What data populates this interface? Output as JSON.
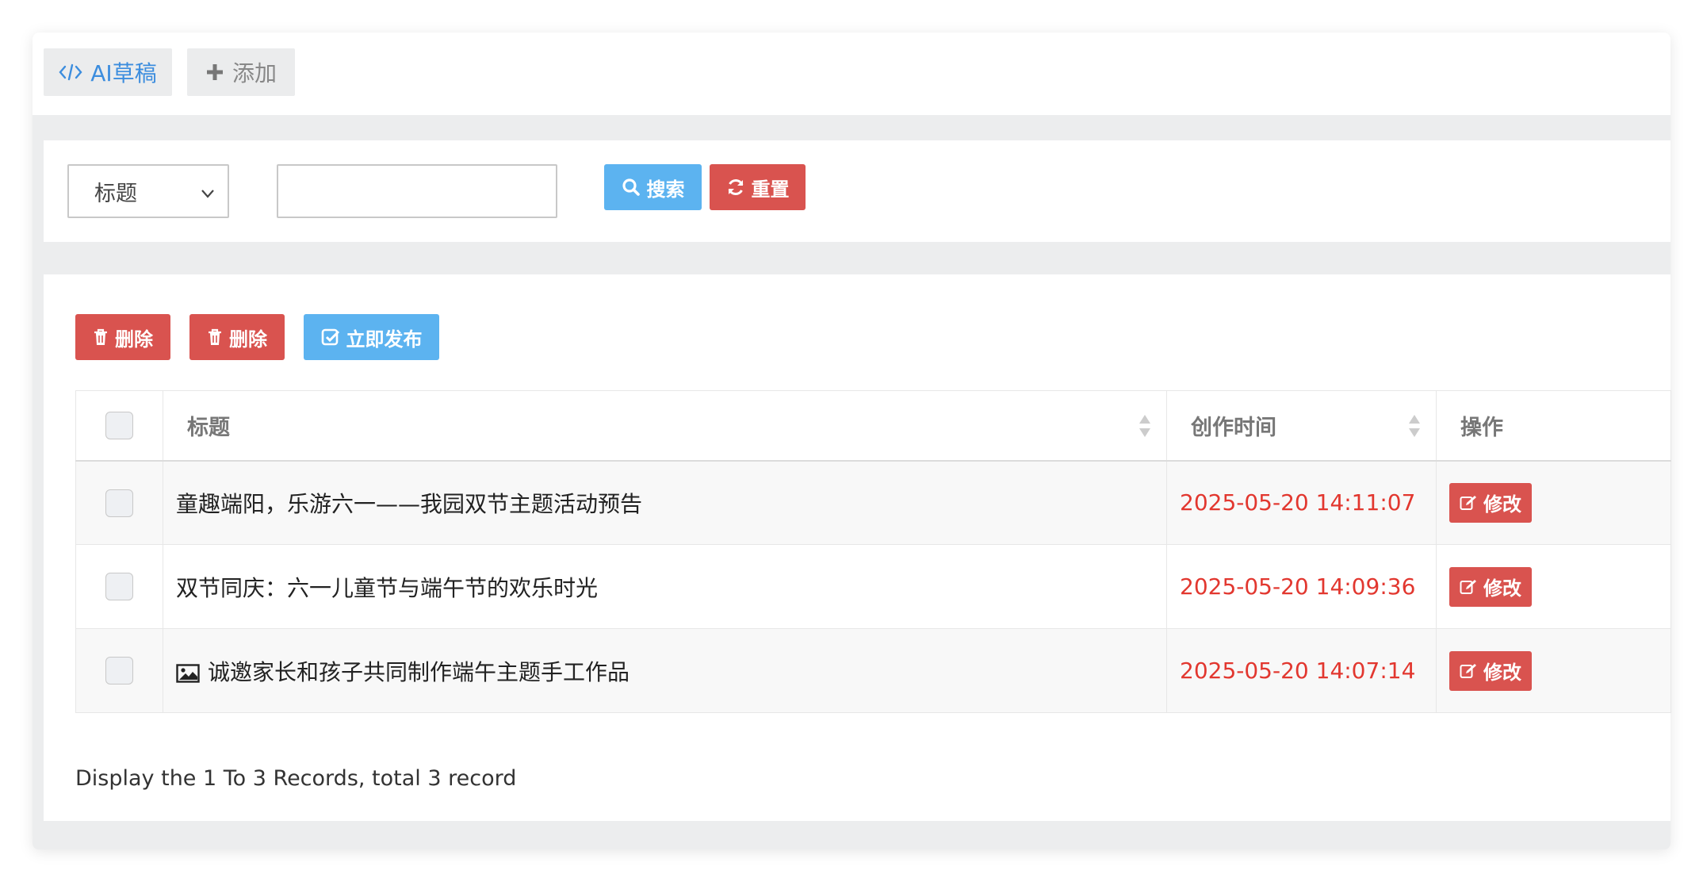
{
  "tabs": {
    "ai_label": "AI草稿",
    "add_label": "添加"
  },
  "search": {
    "field_select": "标题",
    "keyword_value": "",
    "search_label": "搜索",
    "reset_label": "重置"
  },
  "toolbar": {
    "delete1_label": "删除",
    "delete2_label": "删除",
    "publish_label": "立即发布"
  },
  "table": {
    "headers": [
      "标题",
      "创作时间",
      "操作"
    ],
    "rows": [
      {
        "title": "童趣端阳，乐游六一——我园双节主题活动预告",
        "time": "2025-05-20 14:11:07",
        "action": "修改",
        "has_image": false
      },
      {
        "title": "双节同庆：六一儿童节与端午节的欢乐时光",
        "time": "2025-05-20 14:09:36",
        "action": "修改",
        "has_image": false
      },
      {
        "title": "诚邀家长和孩子共同制作端午主题手工作品",
        "time": "2025-05-20 14:07:14",
        "action": "修改",
        "has_image": true
      }
    ]
  },
  "footer": {
    "records_text": "Display the 1 To 3 Records, total 3 record"
  },
  "colors": {
    "primary_blue": "#5cb3f0",
    "danger_red": "#d9534f",
    "time_red": "#e2372f",
    "link_blue": "#3c8dde"
  }
}
